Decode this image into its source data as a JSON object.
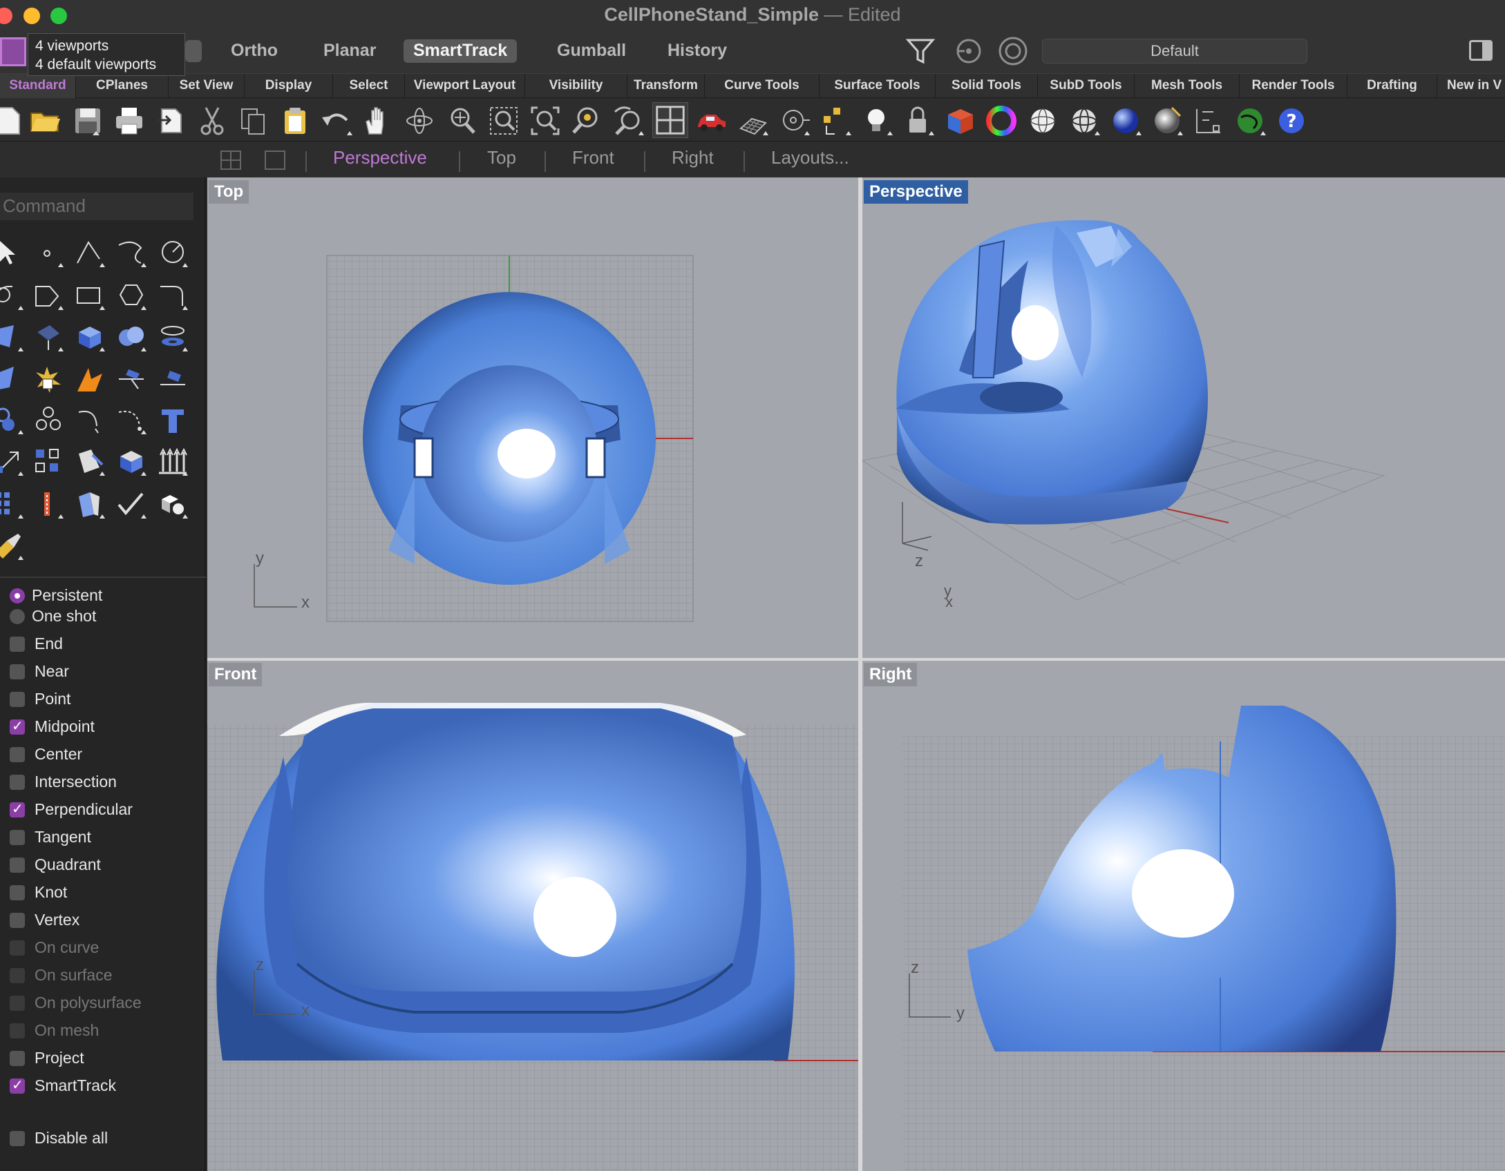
{
  "window": {
    "title": "CellPhoneStand_Simple",
    "separator": "—",
    "status": "Edited"
  },
  "tooltip": {
    "line1": "4 viewports",
    "line2": "4 default viewports"
  },
  "modebar": {
    "items": [
      "Ortho",
      "Planar",
      "SmartTrack",
      "Gumball",
      "History"
    ],
    "active": "SmartTrack",
    "layer": "Default"
  },
  "tabs": [
    "Standard",
    "CPlanes",
    "Set View",
    "Display",
    "Select",
    "Viewport Layout",
    "Visibility",
    "Transform",
    "Curve Tools",
    "Surface Tools",
    "Solid Tools",
    "SubD Tools",
    "Mesh Tools",
    "Render Tools",
    "Drafting",
    "New in V"
  ],
  "active_tab": "Standard",
  "toolbar_icons": [
    "new-file-icon",
    "open-folder-icon",
    "save-icon",
    "print-icon",
    "import-icon",
    "cut-icon",
    "copy-icon",
    "paste-icon",
    "undo-icon",
    "pan-hand-icon",
    "rotate-view-icon",
    "zoom-icon",
    "zoom-window-icon",
    "zoom-extents-icon",
    "zoom-selected-icon",
    "undo-view-icon",
    "four-viewports-icon",
    "car-icon",
    "grid-icon",
    "snap-icon",
    "points-icon",
    "light-bulb-icon",
    "lock-icon",
    "box-render-icon",
    "color-wheel-icon",
    "sphere-wire-icon",
    "sphere-shaded-icon",
    "sphere-blue-icon",
    "sphere-render-icon",
    "dimension-icon",
    "globe-icon",
    "help-icon"
  ],
  "viewport_tabs": {
    "items": [
      "Perspective",
      "Top",
      "Front",
      "Right",
      "Layouts..."
    ],
    "active": "Perspective"
  },
  "command": {
    "placeholder": "Command"
  },
  "osnap": {
    "mode": [
      {
        "label": "Persistent",
        "selected": true
      },
      {
        "label": "One shot",
        "selected": false
      }
    ],
    "items": [
      {
        "label": "End",
        "checked": false,
        "enabled": true
      },
      {
        "label": "Near",
        "checked": false,
        "enabled": true
      },
      {
        "label": "Point",
        "checked": false,
        "enabled": true
      },
      {
        "label": "Midpoint",
        "checked": true,
        "enabled": true
      },
      {
        "label": "Center",
        "checked": false,
        "enabled": true
      },
      {
        "label": "Intersection",
        "checked": false,
        "enabled": true
      },
      {
        "label": "Perpendicular",
        "checked": true,
        "enabled": true
      },
      {
        "label": "Tangent",
        "checked": false,
        "enabled": true
      },
      {
        "label": "Quadrant",
        "checked": false,
        "enabled": true
      },
      {
        "label": "Knot",
        "checked": false,
        "enabled": true
      },
      {
        "label": "Vertex",
        "checked": false,
        "enabled": true
      },
      {
        "label": "On curve",
        "checked": false,
        "enabled": false
      },
      {
        "label": "On surface",
        "checked": false,
        "enabled": false
      },
      {
        "label": "On polysurface",
        "checked": false,
        "enabled": false
      },
      {
        "label": "On mesh",
        "checked": false,
        "enabled": false
      },
      {
        "label": "Project",
        "checked": false,
        "enabled": true
      },
      {
        "label": "SmartTrack",
        "checked": true,
        "enabled": true
      }
    ],
    "disable_all": "Disable all"
  },
  "viewports": {
    "top": {
      "label": "Top",
      "axis1": "y",
      "axis2": "x"
    },
    "perspective": {
      "label": "Perspective",
      "axis1": "z",
      "axis2": "y",
      "axis3": "x"
    },
    "front": {
      "label": "Front",
      "axis1": "z",
      "axis2": "x"
    },
    "right": {
      "label": "Right",
      "axis1": "z",
      "axis2": "y"
    }
  },
  "colors": {
    "accent": "#c07ad6",
    "viewport_bg": "#a3a7ad",
    "model": "#5b8fe0",
    "active_label": "#2f5fa2"
  }
}
